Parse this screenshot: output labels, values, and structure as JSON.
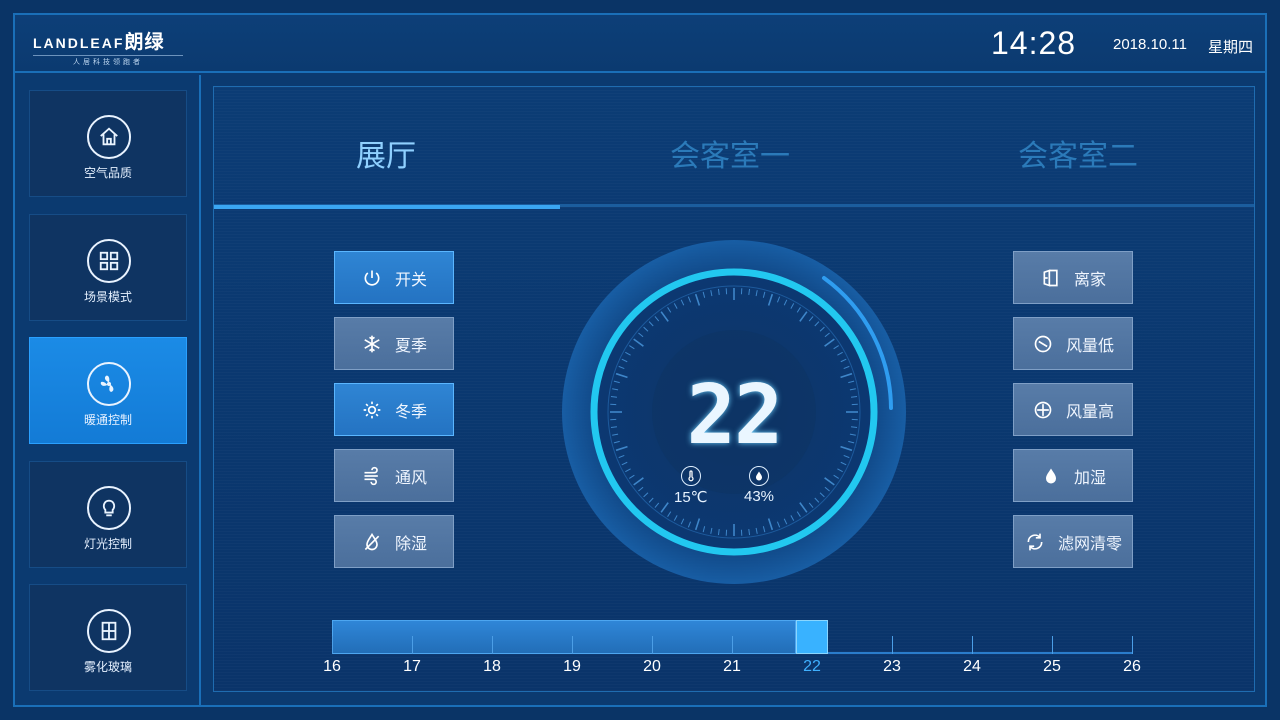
{
  "header": {
    "logo_latin": "LANDLEAF",
    "logo_cn": "朗绿",
    "logo_slogan": "人居科技领跑者",
    "time": "14:28",
    "date": "2018.10.11",
    "weekday": "星期四"
  },
  "sidebar": {
    "items": [
      {
        "label": "空气品质",
        "icon": "home-icon"
      },
      {
        "label": "场景模式",
        "icon": "grid-icon"
      },
      {
        "label": "暖通控制",
        "icon": "fan-icon",
        "active": true
      },
      {
        "label": "灯光控制",
        "icon": "bulb-icon"
      },
      {
        "label": "雾化玻璃",
        "icon": "window-icon"
      }
    ]
  },
  "tabs": [
    {
      "label": "展厅",
      "active": true
    },
    {
      "label": "会客室一"
    },
    {
      "label": "会客室二"
    }
  ],
  "left_buttons": [
    {
      "label": "开关",
      "icon": "power-icon",
      "on": true
    },
    {
      "label": "夏季",
      "icon": "snowflake-icon"
    },
    {
      "label": "冬季",
      "icon": "sun-icon",
      "on": true
    },
    {
      "label": "通风",
      "icon": "wind-icon"
    },
    {
      "label": "除湿",
      "icon": "dehumidify-icon"
    }
  ],
  "right_buttons": [
    {
      "label": "离家",
      "icon": "leave-home-icon"
    },
    {
      "label": "风量低",
      "icon": "fan-low-icon"
    },
    {
      "label": "风量高",
      "icon": "fan-high-icon"
    },
    {
      "label": "加湿",
      "icon": "droplet-icon"
    },
    {
      "label": "滤网清零",
      "icon": "refresh-icon"
    }
  ],
  "dial": {
    "setpoint": "22",
    "indoor_temp": "15℃",
    "humidity": "43%"
  },
  "slider": {
    "min": 16,
    "max": 26,
    "value": 22,
    "ticks": [
      "16",
      "17",
      "18",
      "19",
      "20",
      "21",
      "22",
      "23",
      "24",
      "25",
      "26"
    ]
  },
  "colors": {
    "accent": "#39b2ff",
    "active_nav": "#1b8be6",
    "button": "#587ca8"
  }
}
